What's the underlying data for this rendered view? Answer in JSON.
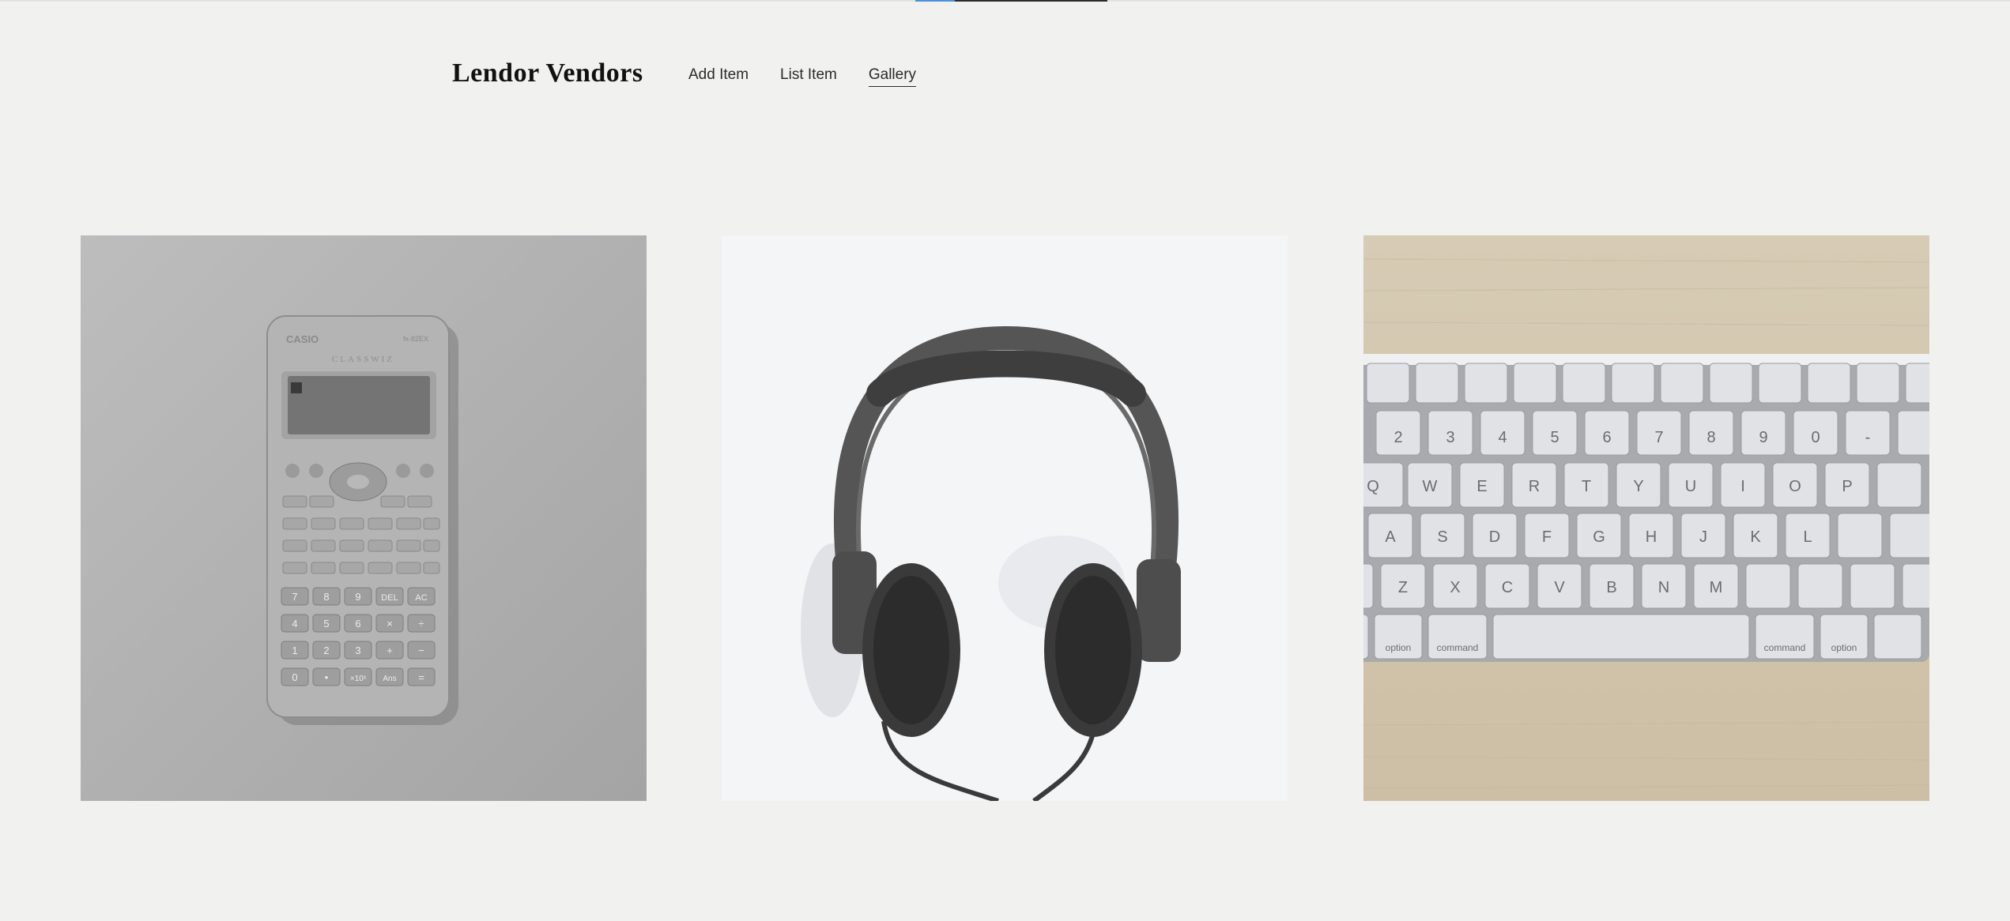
{
  "brand": "Lendor Vendors",
  "nav": {
    "items": [
      {
        "label": "Add Item"
      },
      {
        "label": "List Item"
      },
      {
        "label": "Gallery",
        "active": true
      }
    ]
  },
  "gallery": {
    "items": [
      {
        "subject": "calculator",
        "device_text": {
          "brand": "CASIO",
          "series": "CLASSWIZ",
          "model": "fx-82EX",
          "del": "DEL",
          "ac": "AC",
          "ans": "Ans",
          "exp": "×10ˣ"
        }
      },
      {
        "subject": "headphones"
      },
      {
        "subject": "keyboard",
        "device_text": {
          "command": "command",
          "option": "option"
        }
      }
    ]
  },
  "colors": {
    "background": "#f1f1ef",
    "loader_accent": "#4a8fd8"
  }
}
